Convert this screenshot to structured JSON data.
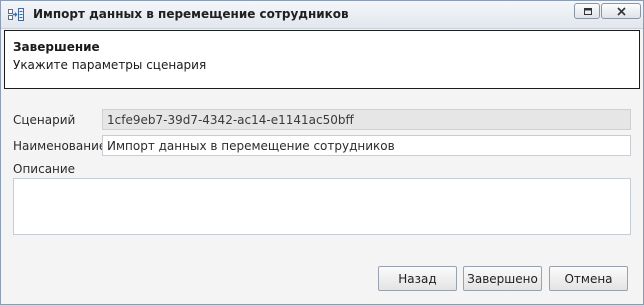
{
  "window": {
    "title": "Импорт данных в перемещение сотрудников",
    "app_icon": "import-wizard-icon",
    "controls": [
      "restore-icon",
      "close-icon"
    ]
  },
  "header": {
    "title": "Завершение",
    "subtitle": "Укажите параметры сценария"
  },
  "form": {
    "scenario_label": "Сценарий",
    "scenario_value": "1cfe9eb7-39d7-4342-ac14-e1141ac50bff",
    "name_label": "Наименование",
    "name_value": "Импорт данных в перемещение сотрудников",
    "description_label": "Описание",
    "description_value": ""
  },
  "buttons": {
    "back": "Назад",
    "finish": "Завершено",
    "cancel": "Отмена"
  },
  "colors": {
    "title_bar": "#e8ecf1",
    "panel_background": "#f4f4f4",
    "readonly_field": "#e6e6e6"
  }
}
